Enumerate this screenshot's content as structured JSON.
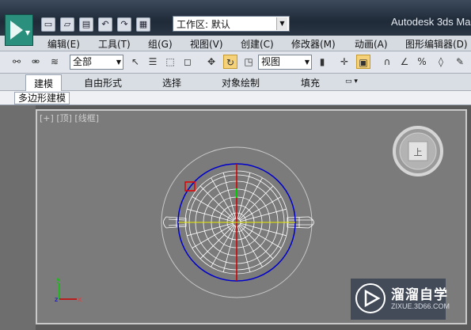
{
  "title_bar": {
    "workspace_label": "工作区: 默认",
    "app_title": "Autodesk 3ds Ma"
  },
  "menu": [
    "编辑(E)",
    "工具(T)",
    "组(G)",
    "视图(V)",
    "创建(C)",
    "修改器(M)",
    "动画(A)",
    "图形编辑器(D)"
  ],
  "toolbar": {
    "selection_filter": "全部",
    "reference_coord": "视图"
  },
  "ribbon": {
    "tabs": [
      "建模",
      "自由形式",
      "选择",
      "对象绘制",
      "填充"
    ],
    "active_tab": "建模",
    "subpanel_tab": "多边形建模"
  },
  "viewport": {
    "label_plus": "[+]",
    "label_view": "[顶]",
    "label_mode": "[线框]",
    "view_cube_face": "上",
    "axis_y": "y",
    "axis_x": "x",
    "colors": {
      "background": "#7b7b7b",
      "mesh": "#ffffff",
      "gizmo_ring": "#0000cc",
      "axis_red": "#cc0000",
      "axis_yellow": "#e8e800",
      "axis_green": "#00cc00"
    }
  },
  "watermark": {
    "title": "溜溜自学",
    "subtitle": "ZIXUE.3D66.COM"
  }
}
